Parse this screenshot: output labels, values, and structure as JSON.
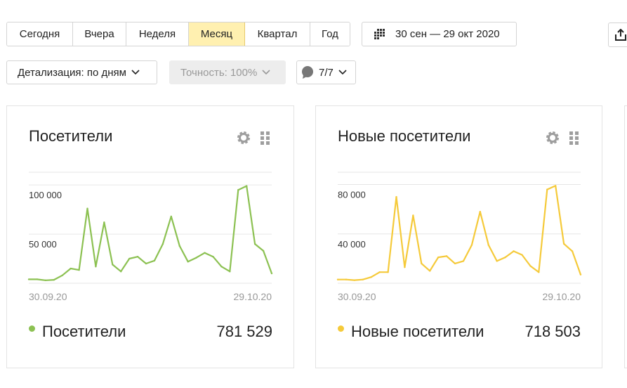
{
  "period_tabs": [
    {
      "label": "Сегодня",
      "active": false
    },
    {
      "label": "Вчера",
      "active": false
    },
    {
      "label": "Неделя",
      "active": false
    },
    {
      "label": "Месяц",
      "active": true
    },
    {
      "label": "Квартал",
      "active": false
    },
    {
      "label": "Год",
      "active": false
    }
  ],
  "date_range": {
    "label": "30 сен — 29 окт 2020",
    "icon": "calendar-icon"
  },
  "export": {
    "icon": "export-icon"
  },
  "detail_select": {
    "label": "Детализация: по дням"
  },
  "accuracy_select": {
    "label": "Точность: 100%"
  },
  "comments_select": {
    "label": "7/7",
    "icon": "comment-icon"
  },
  "widgets": [
    {
      "title": "Посетители",
      "legend_label": "Посетители",
      "total": "781 529",
      "color": "#8cc152",
      "chart_data": {
        "type": "line",
        "ticks": [
          {
            "value": 100000,
            "label": "100 000"
          },
          {
            "value": 50000,
            "label": "50 000"
          }
        ],
        "ylim": [
          0,
          113000
        ],
        "x_labels": [
          "30.09.20",
          "29.10.20"
        ],
        "x_start": "30.09.20",
        "x_end": "29.10.20",
        "series": [
          {
            "values": [
              4000,
              4000,
              3000,
              3500,
              8000,
              15000,
              13500,
              76000,
              17000,
              62000,
              19000,
              12000,
              25000,
              27000,
              20000,
              23000,
              40000,
              68000,
              38000,
              22000,
              26000,
              31000,
              27000,
              17000,
              12000,
              95000,
              99000,
              40000,
              33000,
              10000
            ]
          }
        ]
      }
    },
    {
      "title": "Новые посетители",
      "legend_label": "Новые посетители",
      "total": "718 503",
      "color": "#f5ca3a",
      "chart_data": {
        "type": "line",
        "ticks": [
          {
            "value": 80000,
            "label": "80 000"
          },
          {
            "value": 40000,
            "label": "40 000"
          }
        ],
        "ylim": [
          0,
          90000
        ],
        "x_labels": [
          "30.09.20",
          "29.10.20"
        ],
        "x_start": "30.09.20",
        "x_end": "29.10.20",
        "series": [
          {
            "values": [
              3000,
              3000,
              2500,
              3000,
              5000,
              9000,
              9000,
              70000,
              13000,
              55000,
              16000,
              10000,
              21000,
              22000,
              16000,
              18000,
              31000,
              58000,
              31000,
              18000,
              21000,
              26000,
              23000,
              14000,
              9000,
              76000,
              79000,
              32000,
              26000,
              7000
            ]
          }
        ]
      }
    }
  ]
}
